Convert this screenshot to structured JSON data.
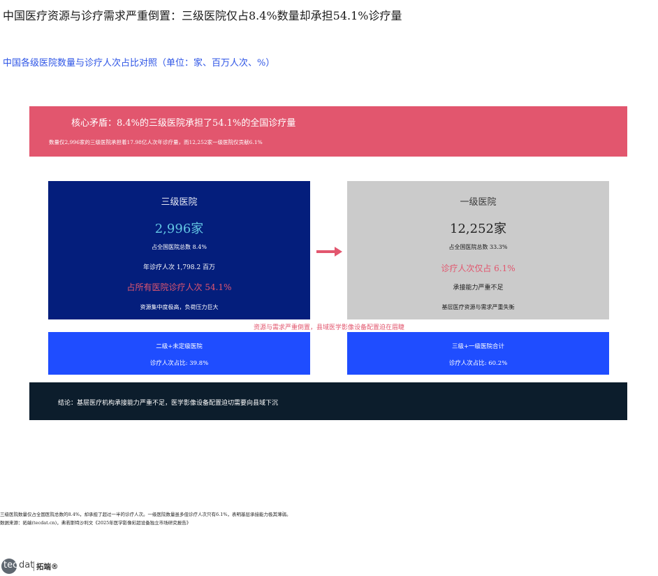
{
  "header": {
    "title": "中国医疗资源与诊疗需求严重倒置：三级医院仅占8.4%数量却承担54.1%诊疗量",
    "subtitle": "中国各级医院数量与诊疗人次占比对照（单位：家、百万人次、%）"
  },
  "core_banner": {
    "title": "核心矛盾：8.4%的三级医院承担了54.1%的全国诊疗量",
    "detail": "数量仅2,996家的三级医院承担着17.98亿人次年诊疗量，而12,252家一级医院仅贡献6.1%"
  },
  "cards": {
    "tertiary": {
      "title": "三级医院",
      "count": "2,996家",
      "share": "占全国医院总数 8.4%",
      "visits": "年诊疗人次 1,798.2 百万",
      "highlight": "占所有医院诊疗人次 54.1%",
      "note": "资源集中度极高，负荷压力巨大"
    },
    "primary": {
      "title": "一级医院",
      "count": "12,252家",
      "share": "占全国医院总数 33.3%",
      "highlight": "诊疗人次仅占 6.1%",
      "capacity": "承接能力严重不足",
      "note": "基层医疗资源与需求严重失衡"
    }
  },
  "gap_note": "资源与需求严重倒置，县域医学影像设备配置迫在眉睫",
  "boxes": {
    "secondary": {
      "label": "二级+未定级医院",
      "value": "诊疗人次占比: 39.8%"
    },
    "combined": {
      "label": "三级+一级医院合计",
      "value": "诊疗人次占比: 60.2%"
    }
  },
  "conclusion": "结论：基层医疗机构承接能力严重不足，医学影像设备配置迫切需要向县域下沉",
  "footer": {
    "footnote": "三级医院数量仅占全国医院总数的8.4%，却承担了超过一半的诊疗人次。一级医院数量虽多但诊疗人次只有6.1%，表明基层承接能力极其薄弱。",
    "source": "数据来源：拓端(tecdat.cn)，弗若斯特沙利文《2025年医学影像彩超设备独立市场研究报告》"
  },
  "logo": {
    "tec": "tec",
    "dat": "dat",
    "cn": "拓端®"
  },
  "colors": {
    "accent_red": "#e2566e",
    "navy": "#041e7c",
    "gray": "#cbcbcb",
    "blue": "#1f4dff",
    "dark": "#0c1d2c",
    "subtitle_blue": "#2e55e6",
    "cyan": "#63c6e3"
  },
  "icons": {
    "arrow": "arrow-right-icon"
  }
}
